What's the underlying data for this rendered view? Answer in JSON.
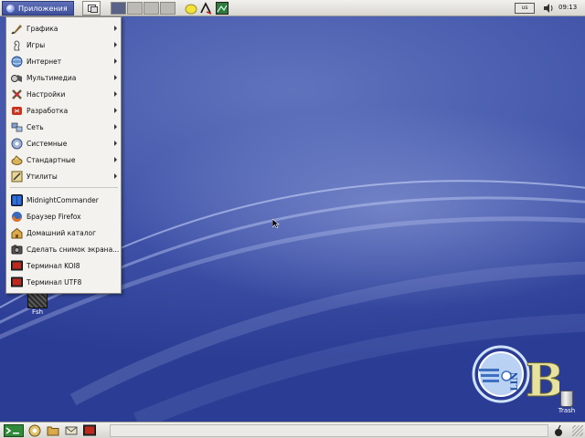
{
  "top_panel": {
    "applications_label": "Приложения",
    "keyboard_layout": "us",
    "clock": "09:13"
  },
  "app_menu": {
    "categories": [
      {
        "label": "Графика",
        "icon": "graphics-icon"
      },
      {
        "label": "Игры",
        "icon": "games-icon"
      },
      {
        "label": "Интернет",
        "icon": "internet-icon"
      },
      {
        "label": "Мультимедиа",
        "icon": "multimedia-icon"
      },
      {
        "label": "Настройки",
        "icon": "settings-icon"
      },
      {
        "label": "Разработка",
        "icon": "development-icon"
      },
      {
        "label": "Сеть",
        "icon": "network-icon"
      },
      {
        "label": "Системные",
        "icon": "system-icon"
      },
      {
        "label": "Стандартные",
        "icon": "accessories-icon"
      },
      {
        "label": "Утилиты",
        "icon": "utilities-icon"
      }
    ],
    "launchers": [
      {
        "label": "MidnightCommander",
        "icon": "midnight-commander-icon"
      },
      {
        "label": "Браузер Firefox",
        "icon": "firefox-icon"
      },
      {
        "label": "Домашний каталог",
        "icon": "home-folder-icon"
      },
      {
        "label": "Сделать снимок экрана...",
        "icon": "screenshot-icon"
      },
      {
        "label": "Терминал KOI8",
        "icon": "terminal-icon"
      },
      {
        "label": "Терминал UTF8",
        "icon": "terminal-icon"
      }
    ]
  },
  "desktop": {
    "folder_icon_label": "Fsh",
    "trash_label": "Trash",
    "logo_text": "LIN"
  }
}
